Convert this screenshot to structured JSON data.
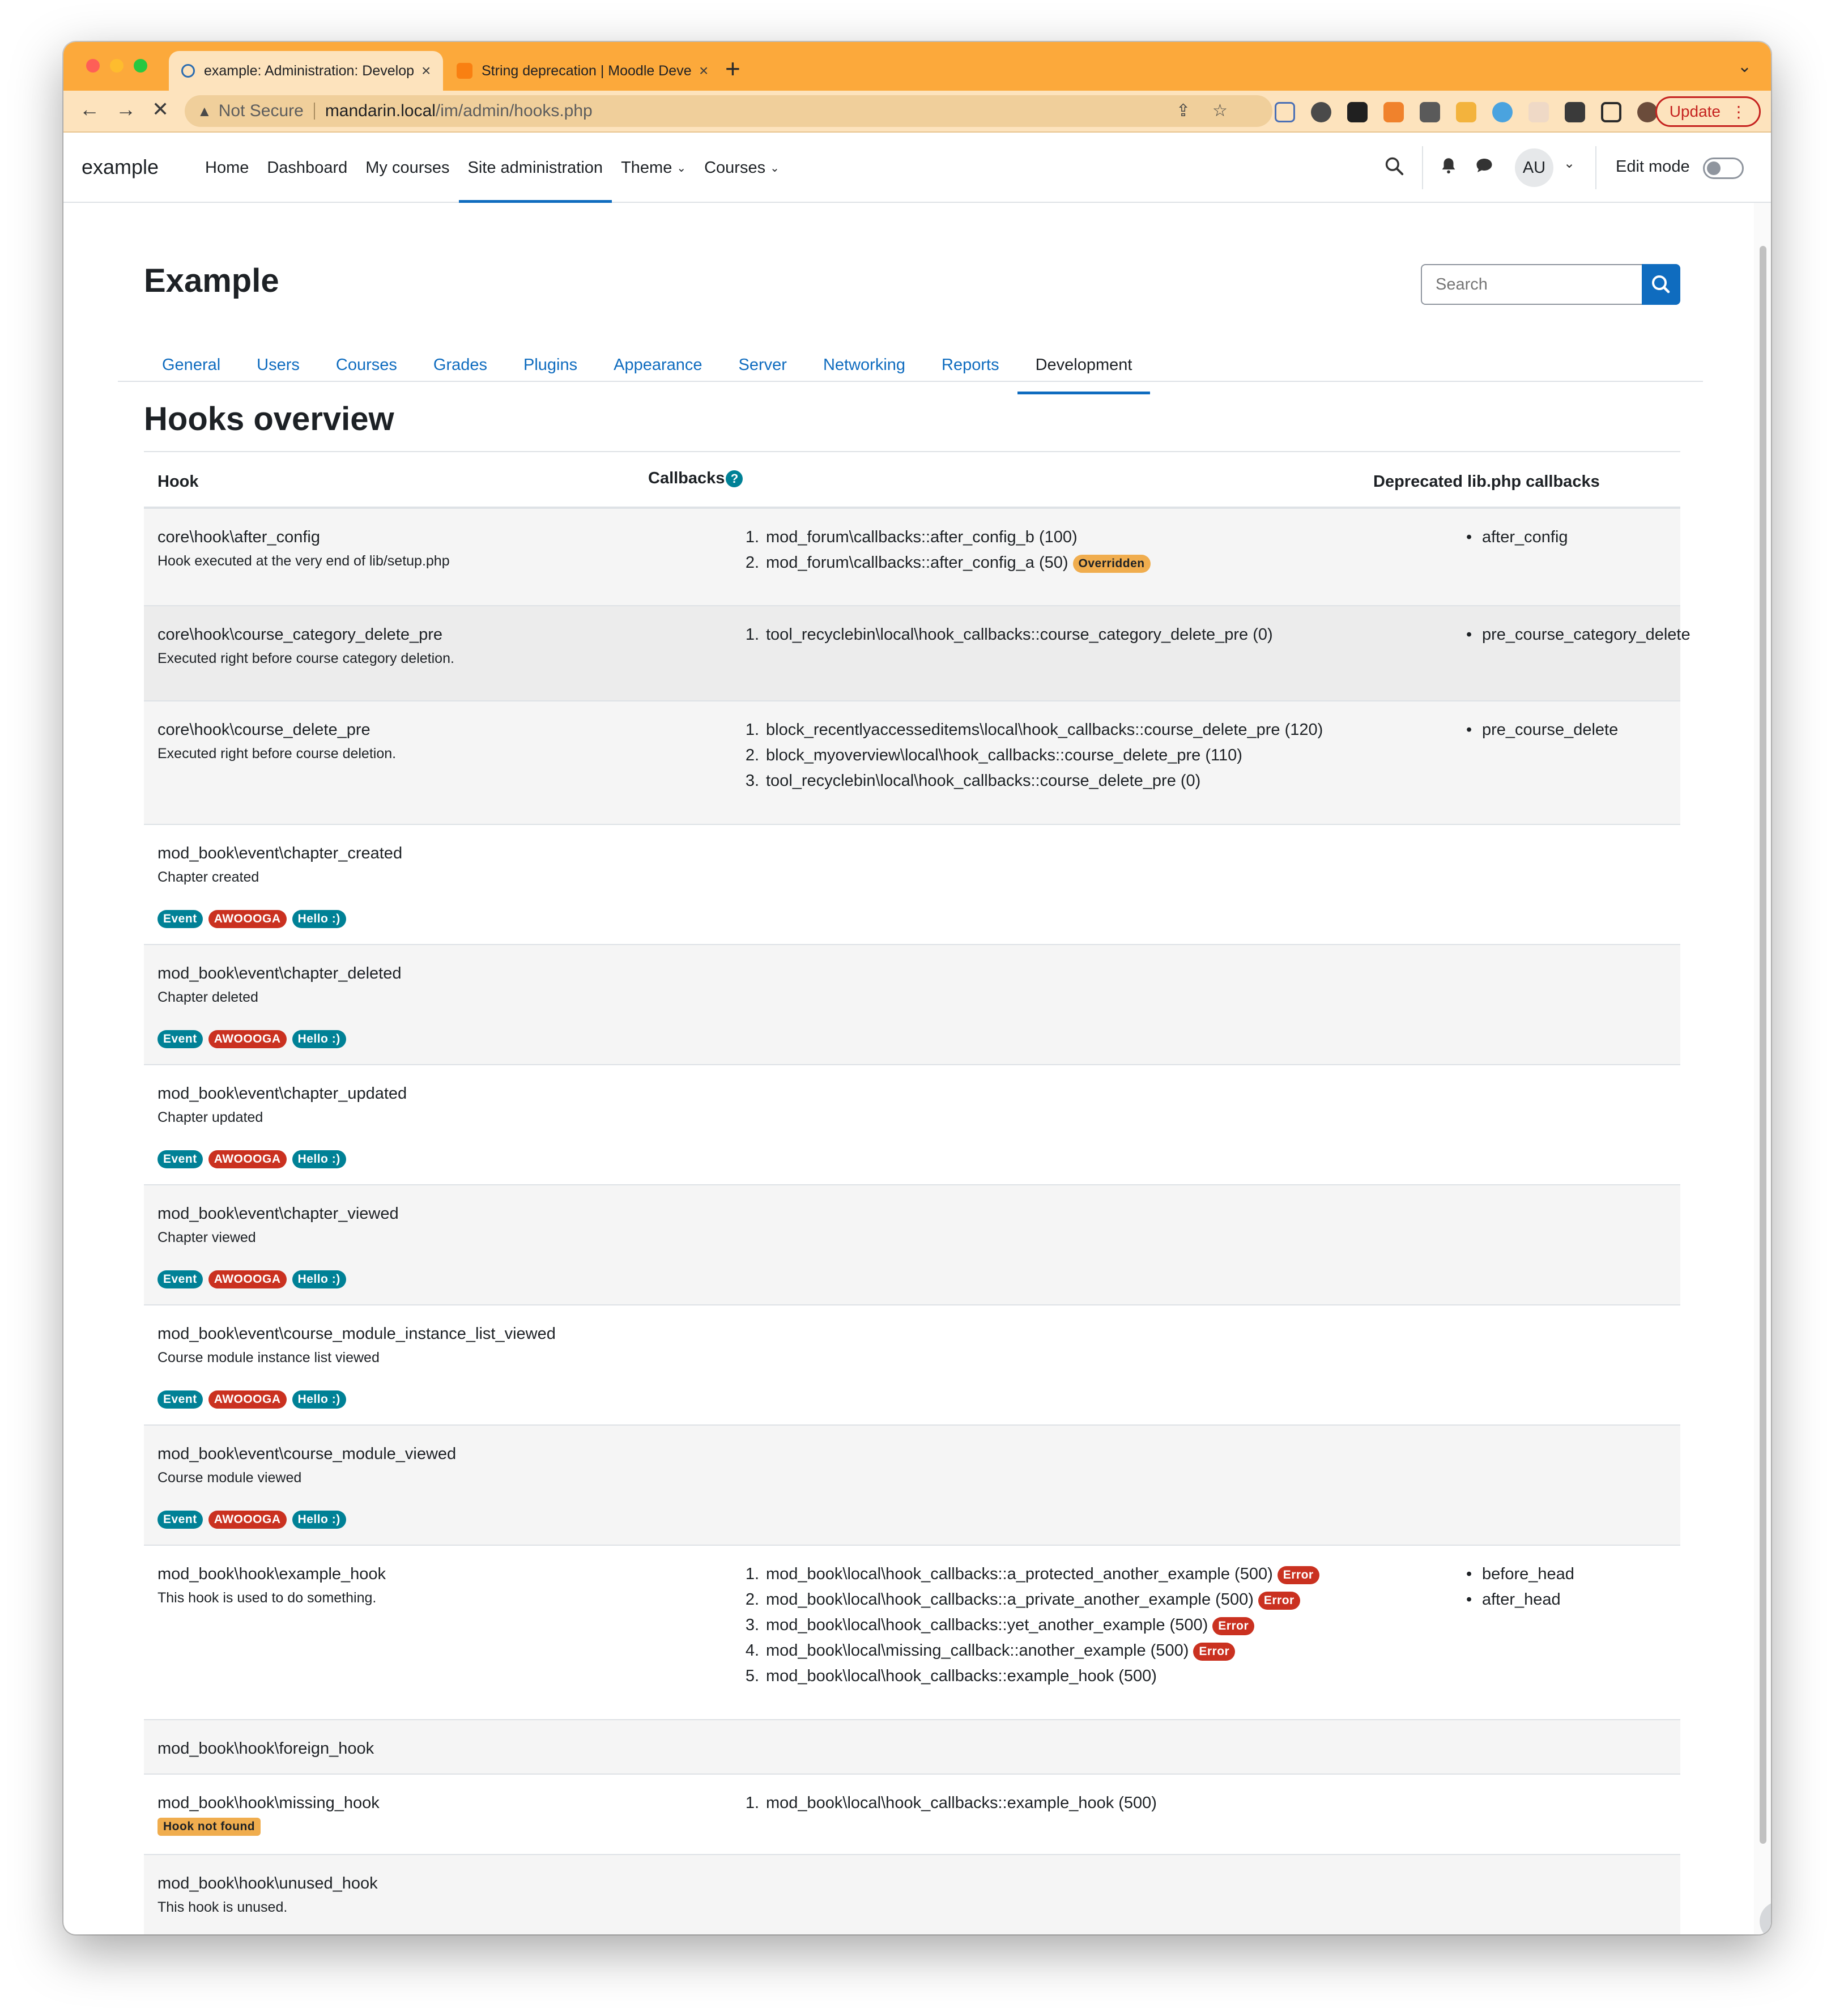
{
  "browser": {
    "tabs": [
      {
        "title": "example: Administration: Development: Hooks overview",
        "active": true
      },
      {
        "title": "String deprecation | Moodle Developer Resources",
        "active": false
      }
    ],
    "new_tab": "+",
    "tab_close": "×",
    "address": {
      "security": "Not Secure",
      "host": "mandarin.local",
      "path": "/im/admin/hooks.php"
    },
    "update_label": "Update",
    "update_menu": "⋮",
    "colors": {
      "tabbar": "#fca93b",
      "toolbar": "#fde3bd",
      "update": "#c5221f"
    }
  },
  "navbar": {
    "brand": "example",
    "items": [
      {
        "label": "Home"
      },
      {
        "label": "Dashboard"
      },
      {
        "label": "My courses"
      },
      {
        "label": "Site administration",
        "active": true
      },
      {
        "label": "Theme",
        "dropdown": true
      },
      {
        "label": "Courses",
        "dropdown": true
      }
    ],
    "avatar_initials": "AU",
    "edit_mode_label": "Edit mode",
    "edit_mode_on": false
  },
  "header": {
    "title": "Example",
    "search_placeholder": "Search"
  },
  "admin_tabs": [
    {
      "label": "General"
    },
    {
      "label": "Users"
    },
    {
      "label": "Courses"
    },
    {
      "label": "Grades"
    },
    {
      "label": "Plugins"
    },
    {
      "label": "Appearance"
    },
    {
      "label": "Server"
    },
    {
      "label": "Networking"
    },
    {
      "label": "Reports"
    },
    {
      "label": "Development",
      "active": true
    }
  ],
  "main": {
    "heading": "Hooks overview",
    "columns": {
      "hook": "Hook",
      "callbacks": "Callbacks",
      "help": "?",
      "deprecated": "Deprecated lib.php callbacks"
    },
    "rows": [
      {
        "hook": "core\\hook\\after_config",
        "description": "Hook executed at the very end of lib/setup.php",
        "callbacks": [
          {
            "num": "1.",
            "text": "mod_forum\\callbacks::after_config_b (100)"
          },
          {
            "num": "2.",
            "text": "mod_forum\\callbacks::after_config_a (50)",
            "badge": "Overridden",
            "badge_type": "over"
          }
        ],
        "deprecated": [
          "after_config"
        ]
      },
      {
        "hook": "core\\hook\\course_category_delete_pre",
        "description": "Executed right before course category deletion.",
        "callbacks": [
          {
            "num": "1.",
            "text": "tool_recyclebin\\local\\hook_callbacks::course_category_delete_pre (0)"
          }
        ],
        "deprecated": [
          "pre_course_category_delete"
        ]
      },
      {
        "hook": "core\\hook\\course_delete_pre",
        "description": "Executed right before course deletion.",
        "callbacks": [
          {
            "num": "1.",
            "text": "block_recentlyaccesseditems\\local\\hook_callbacks::course_delete_pre (120)"
          },
          {
            "num": "2.",
            "text": "block_myoverview\\local\\hook_callbacks::course_delete_pre (110)"
          },
          {
            "num": "3.",
            "text": "tool_recyclebin\\local\\hook_callbacks::course_delete_pre (0)"
          }
        ],
        "deprecated": [
          "pre_course_delete"
        ]
      },
      {
        "hook": "mod_book\\event\\chapter_created",
        "description": "Chapter created",
        "tags": [
          "Event",
          "AWOOOGA",
          "Hello :)"
        ]
      },
      {
        "hook": "mod_book\\event\\chapter_deleted",
        "description": "Chapter deleted",
        "tags": [
          "Event",
          "AWOOOGA",
          "Hello :)"
        ]
      },
      {
        "hook": "mod_book\\event\\chapter_updated",
        "description": "Chapter updated",
        "tags": [
          "Event",
          "AWOOOGA",
          "Hello :)"
        ]
      },
      {
        "hook": "mod_book\\event\\chapter_viewed",
        "description": "Chapter viewed",
        "tags": [
          "Event",
          "AWOOOGA",
          "Hello :)"
        ]
      },
      {
        "hook": "mod_book\\event\\course_module_instance_list_viewed",
        "description": "Course module instance list viewed",
        "tags": [
          "Event",
          "AWOOOGA",
          "Hello :)"
        ]
      },
      {
        "hook": "mod_book\\event\\course_module_viewed",
        "description": "Course module viewed",
        "tags": [
          "Event",
          "AWOOOGA",
          "Hello :)"
        ]
      },
      {
        "hook": "mod_book\\hook\\example_hook",
        "description": "This hook is used to do something.",
        "callbacks": [
          {
            "num": "1.",
            "text": "mod_book\\local\\hook_callbacks::a_protected_another_example (500)",
            "badge": "Error",
            "badge_type": "err"
          },
          {
            "num": "2.",
            "text": "mod_book\\local\\hook_callbacks::a_private_another_example (500)",
            "badge": "Error",
            "badge_type": "err"
          },
          {
            "num": "3.",
            "text": "mod_book\\local\\hook_callbacks::yet_another_example (500)",
            "badge": "Error",
            "badge_type": "err"
          },
          {
            "num": "4.",
            "text": "mod_book\\local\\missing_callback::another_example (500)",
            "badge": "Error",
            "badge_type": "err"
          },
          {
            "num": "5.",
            "text": "mod_book\\local\\hook_callbacks::example_hook (500)"
          }
        ],
        "deprecated": [
          "before_head",
          "after_head"
        ]
      },
      {
        "hook": "mod_book\\hook\\foreign_hook"
      },
      {
        "hook": "mod_book\\hook\\missing_hook",
        "status_badge": "Hook not found",
        "callbacks": [
          {
            "num": "1.",
            "text": "mod_book\\local\\hook_callbacks::example_hook (500)"
          }
        ]
      },
      {
        "hook": "mod_book\\hook\\unused_hook",
        "description": "This hook is unused."
      }
    ],
    "help_button": "?"
  }
}
